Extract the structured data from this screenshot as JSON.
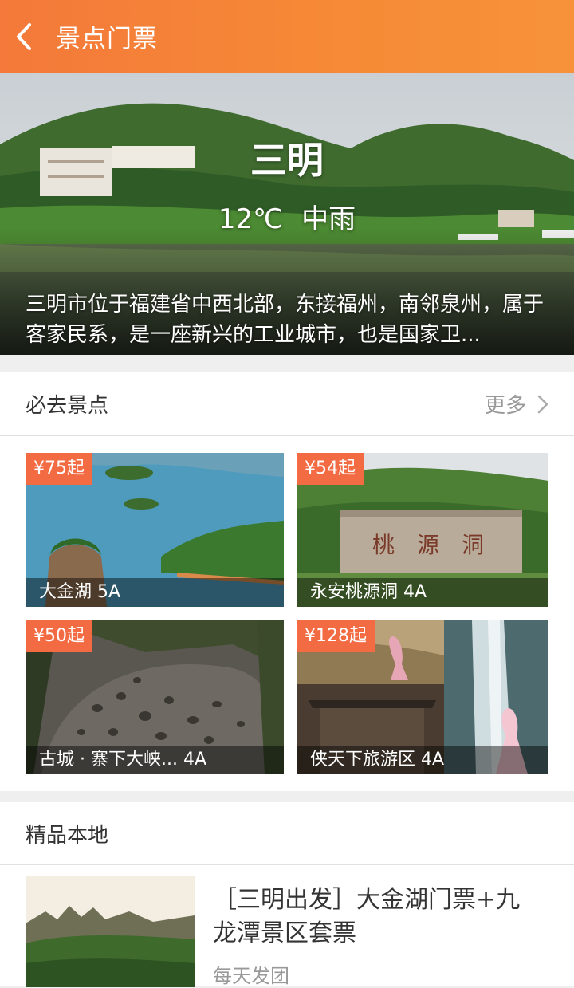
{
  "header": {
    "title": "景点门票",
    "back_icon": "chevron-left-icon"
  },
  "hero": {
    "city": "三明",
    "temperature": "12℃",
    "weather": "中雨",
    "description": "三明市位于福建省中西北部，东接福州，南邻泉州，属于客家民系，是一座新兴的工业城市，也是国家卫..."
  },
  "must_visit": {
    "title": "必去景点",
    "more_label": "更多",
    "items": [
      {
        "price": "¥75起",
        "name": "大金湖 5A"
      },
      {
        "price": "¥54起",
        "name": "永安桃源洞 4A"
      },
      {
        "price": "¥50起",
        "name": "古城 · 寨下大峡... 4A"
      },
      {
        "price": "¥128起",
        "name": "侠天下旅游区 4A"
      }
    ]
  },
  "local": {
    "title": "精品本地",
    "items": [
      {
        "title": "［三明出发］大金湖门票+九龙潭景区套票",
        "subtitle": "每天发团"
      }
    ]
  },
  "colors": {
    "accent": "#f68a36",
    "price_tag": "#f36b43"
  }
}
